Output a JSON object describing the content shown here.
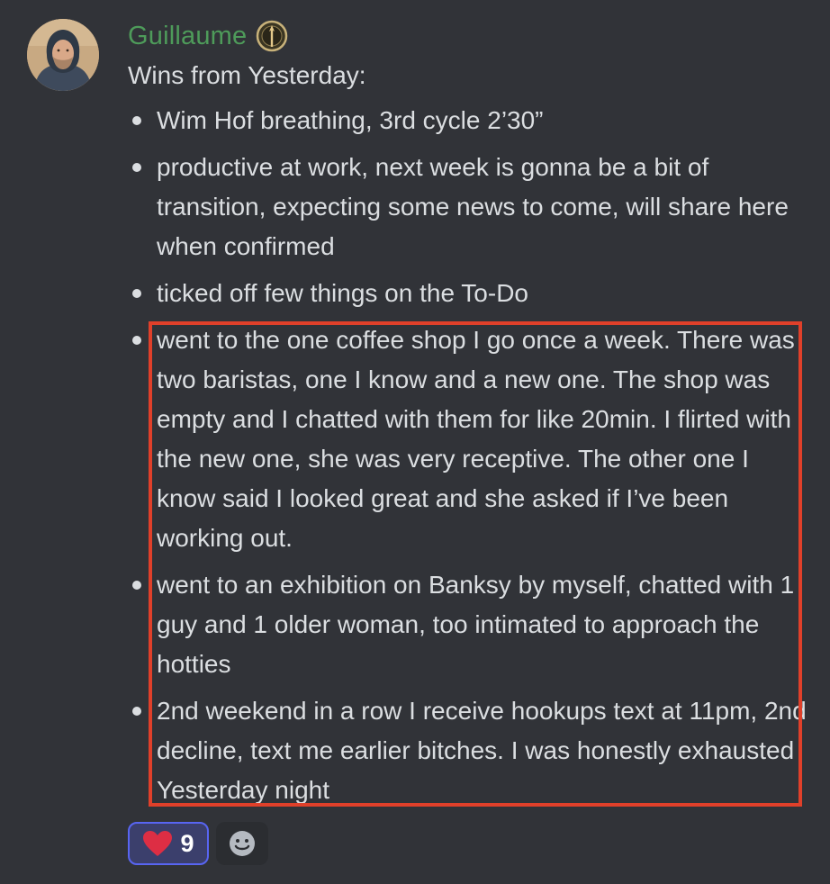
{
  "message": {
    "author": {
      "name": "Guillaume",
      "name_color": "#4e9b5a",
      "avatar_icon": "user-avatar-photo",
      "badge_icon": "role-badge-icon"
    },
    "intro": "Wins from Yesterday:",
    "wins": [
      "Wim Hof breathing, 3rd cycle 2’30”",
      "productive at work, next week is gonna be a bit of transition, expecting some news to come, will share here when confirmed",
      "ticked off few things on the To-Do",
      "went to the one coffee shop I go once a week. There was two baristas, one I know and a new one. The shop was empty and I chatted with them for like 20min. I flirted with the new one, she was very receptive. The other one I know said I looked great and she asked if I’ve been working out.",
      "went to an exhibition on Banksy by myself, chatted with 1 guy and 1 older woman, too intimated to approach the hotties",
      "2nd weekend in a row I receive hookups text at 11pm, 2nd decline, text me earlier bitches. I was honestly exhausted Yesterday night"
    ],
    "highlight_color": "#e0402a",
    "reactions": [
      {
        "emoji": "heart-icon",
        "count": "9",
        "active": true,
        "accent": "#5865f2"
      },
      {
        "emoji": "add-reaction-icon",
        "count": "",
        "active": false
      }
    ]
  },
  "theme": {
    "background": "#313338",
    "text": "#dbdee1"
  }
}
